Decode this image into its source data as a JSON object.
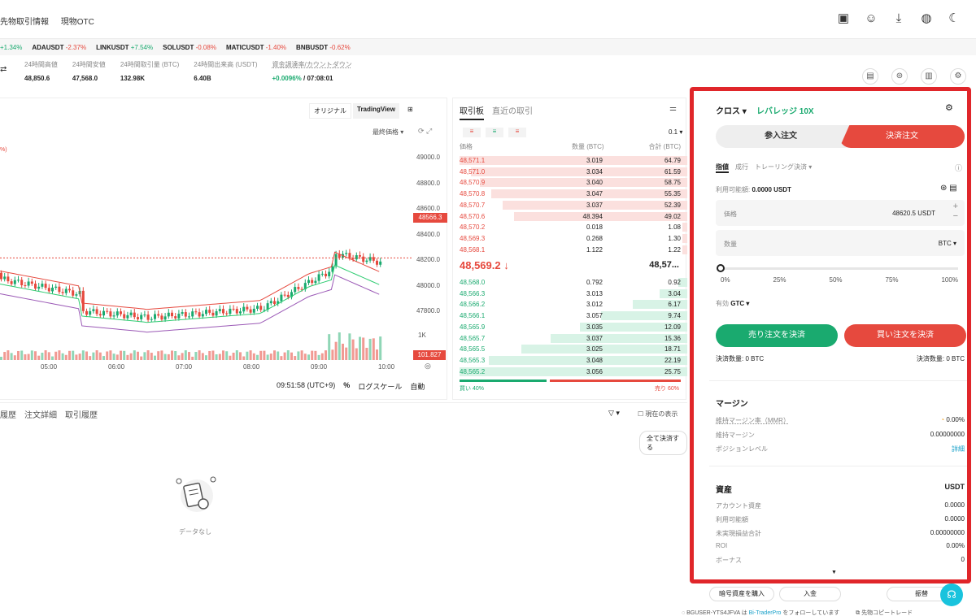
{
  "topnav": {
    "links": [
      "先物取引情報",
      "現物OTC"
    ]
  },
  "ticker": [
    {
      "sym": "",
      "chg": "+1.34%",
      "dir": "up"
    },
    {
      "sym": "ADAUSDT",
      "chg": "-2.37%",
      "dir": "dn"
    },
    {
      "sym": "LINKUSDT",
      "chg": "+7.54%",
      "dir": "up"
    },
    {
      "sym": "SOLUSDT",
      "chg": "-0.08%",
      "dir": "dn"
    },
    {
      "sym": "MATICUSDT",
      "chg": "-1.40%",
      "dir": "dn"
    },
    {
      "sym": "BNBUSDT",
      "chg": "-0.62%",
      "dir": "dn"
    }
  ],
  "stats": [
    {
      "label": "24時間高値",
      "value": "48,850.6"
    },
    {
      "label": "24時間安値",
      "value": "47,568.0"
    },
    {
      "label": "24時間取引量 (BTC)",
      "value": "132.98K"
    },
    {
      "label": "24時間出来高 (USDT)",
      "value": "6.40B"
    },
    {
      "label": "資金調達率/カウントダウン",
      "value": "+0.0096%",
      "value2": "/ 07:08:01"
    }
  ],
  "chart": {
    "view_original": "オリジナル",
    "view_tv": "TradingView",
    "price_mode": "最終価格 ▾",
    "ylabels": [
      "49000.0",
      "48800.0",
      "48600.0",
      "48400.0",
      "48200.0",
      "48000.0",
      "47800.0"
    ],
    "current_price": "48566.3",
    "vol_label": "1K",
    "vol_value": "101.827",
    "xlabels": [
      "05:00",
      "06:00",
      "07:00",
      "08:00",
      "09:00",
      "10:00"
    ],
    "time": "09:51:58 (UTC+9)",
    "pct": "%",
    "log": "ログスケール",
    "auto": "自動"
  },
  "orderbook": {
    "tabs": [
      "取引板",
      "直近の取引"
    ],
    "decimals": "0.1",
    "headers": [
      "価格",
      "数量 (BTC)",
      "合計 (BTC)"
    ],
    "asks": [
      {
        "p": "48,571.1",
        "a": "3.019",
        "t": "64.79",
        "w": 1.0
      },
      {
        "p": "48,571.0",
        "a": "3.034",
        "t": "61.59",
        "w": 0.95
      },
      {
        "p": "48,570.9",
        "a": "3.040",
        "t": "58.75",
        "w": 0.91
      },
      {
        "p": "48,570.8",
        "a": "3.047",
        "t": "55.35",
        "w": 0.86
      },
      {
        "p": "48,570.7",
        "a": "3.037",
        "t": "52.39",
        "w": 0.81
      },
      {
        "p": "48,570.6",
        "a": "48.394",
        "t": "49.02",
        "w": 0.76
      },
      {
        "p": "48,570.2",
        "a": "0.018",
        "t": "1.08",
        "w": 0.02
      },
      {
        "p": "48,569.3",
        "a": "0.268",
        "t": "1.30",
        "w": 0.02
      },
      {
        "p": "48,568.1",
        "a": "1.122",
        "t": "1.22",
        "w": 0.02
      }
    ],
    "mid_price": "48,569.2",
    "mid_arrow": "↓",
    "mid_right": "48,57...",
    "bids": [
      {
        "p": "48,568.0",
        "a": "0.792",
        "t": "0.92",
        "w": 0.04
      },
      {
        "p": "48,566.3",
        "a": "3.013",
        "t": "3.04",
        "w": 0.12
      },
      {
        "p": "48,566.2",
        "a": "3.012",
        "t": "6.17",
        "w": 0.24
      },
      {
        "p": "48,566.1",
        "a": "3.057",
        "t": "9.74",
        "w": 0.38
      },
      {
        "p": "48,565.9",
        "a": "3.035",
        "t": "12.09",
        "w": 0.47
      },
      {
        "p": "48,565.7",
        "a": "3.037",
        "t": "15.36",
        "w": 0.6
      },
      {
        "p": "48,565.5",
        "a": "3.025",
        "t": "18.71",
        "w": 0.73
      },
      {
        "p": "48,565.3",
        "a": "3.048",
        "t": "22.19",
        "w": 0.87
      },
      {
        "p": "48,565.2",
        "a": "3.056",
        "t": "25.75",
        "w": 1.0
      }
    ],
    "buy_ratio": "買い 40%",
    "sell_ratio": "売り 60%"
  },
  "bottom": {
    "tabs": [
      "履歴",
      "注文詳細",
      "取引履歴"
    ],
    "show_current": "現在の表示",
    "close_all": "全て決済する",
    "empty": "データなし"
  },
  "panel": {
    "margin_mode": "クロス ▾",
    "leverage": "レバレッジ 10X",
    "open_tab": "参入注文",
    "close_tab": "決済注文",
    "order_types": [
      "指値",
      "成行",
      "トレーリング決済 ▾"
    ],
    "available_label": "利用可能額:",
    "available_value": "0.0000 USDT",
    "price_label": "価格",
    "price_value": "48620.5 USDT",
    "qty_label": "数量",
    "qty_unit": "BTC ▾",
    "slider_marks": [
      "0%",
      "25%",
      "50%",
      "75%",
      "100%"
    ],
    "tif_label": "有効",
    "tif_value": "GTC ▾",
    "close_long": "売り注文を決済",
    "close_short": "買い注文を決済",
    "close_qty_left": "決済数量: 0 BTC",
    "close_qty_right": "決済数量: 0 BTC",
    "margin_title": "マージン",
    "mmr_label": "維持マージン率（MMR）",
    "mmr_value": "0.00%",
    "maint_label": "維持マージン",
    "maint_value": "0.00000000",
    "pos_label": "ポジションレベル",
    "pos_value": "詳細",
    "assets_title": "資産",
    "assets_unit": "USDT",
    "assets": [
      {
        "label": "アカウント資産",
        "value": "0.0000"
      },
      {
        "label": "利用可能額",
        "value": "0.0000"
      },
      {
        "label": "未実現損益合計",
        "value": "0.00000000"
      },
      {
        "label": "ROI",
        "value": "0.00%"
      },
      {
        "label": "ボーナス",
        "value": "0"
      }
    ],
    "buy_crypto": "暗号資産を購入",
    "deposit": "入金",
    "transfer": "振替"
  },
  "footer": {
    "user": "BGUSER-YTS4JFVA",
    "is": "は",
    "trader": "Bi-TraderPro",
    "follow": "をフォローしています",
    "copy": "先物コピートレード"
  },
  "colors": {
    "accent_red": "#e6493e",
    "accent_green": "#1aaa6f",
    "highlight": "#e0262a"
  }
}
